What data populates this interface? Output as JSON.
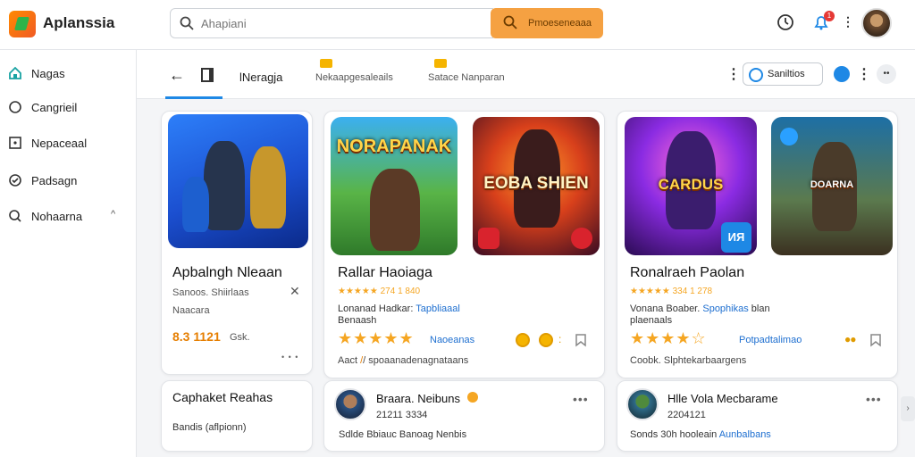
{
  "app": {
    "title": "Aplanssia"
  },
  "search": {
    "placeholder": "Ahapiani",
    "button_label": "Pmoeseneaaa"
  },
  "header": {
    "notification_count": "1"
  },
  "sidebar": {
    "items": [
      {
        "label": "Nagas",
        "icon": "home-icon"
      },
      {
        "label": "Cangrieil",
        "icon": "circle-icon"
      },
      {
        "label": "Nepaceaal",
        "icon": "square-dot-icon"
      },
      {
        "label": "Padsagn",
        "icon": "check-circle-icon"
      },
      {
        "label": "Nohaarna",
        "icon": "search-circle-icon",
        "chevron": "^"
      }
    ]
  },
  "toolbar": {
    "tabs": [
      {
        "label": "lNeragja"
      },
      {
        "label": "Nekaapgesaleails"
      },
      {
        "label": "Satace Nanparan"
      }
    ],
    "pill_label": "Saniltios",
    "circle_label": "••"
  },
  "cards": [
    {
      "title": "Apbalngh Nleaan",
      "meta": "Sanoos. Shiirlaas",
      "sub": "Naacara",
      "price": "8.3 1121",
      "price_suffix": "Gsk.",
      "footer_dots": "• • •"
    },
    {
      "title": "Rallar Haoiaga",
      "art_title": "NORAPANAK",
      "art_title2": "EOBA SHIEN",
      "rating_text": "★★★★★ 274 1 840",
      "desc": "Lonanad Hadkar:",
      "desc_link": "Tapbliaaal",
      "desc2": "Benaash",
      "stars": "★★★★★",
      "stars_label": "Naoeanas",
      "footer": "Aact",
      "footer2": "/ spoaanadenagnataans"
    },
    {
      "title": "Ronalraeh Paolan",
      "art_title": "CARDUS",
      "art_title2": "DOARNA",
      "badge_label": "ИЯ",
      "rating_text": "★★★★★ 334 1 278",
      "desc": "Vonana Boaber. ",
      "desc_link": "Spophikas",
      "desc_tail": "blan",
      "desc2": "plaenaals",
      "stars": "★★★★☆",
      "stars_label": "Potpadtalimao",
      "footer": "Coobk. Slphtekarbaargens"
    }
  ],
  "bottom_cards": [
    {
      "title": "Caphaket Reahas",
      "sub": "Bandis (aflpionn)"
    },
    {
      "title": "Braara. Neibuns",
      "nums": "21211 3334",
      "desc": "Sdlde Bbiauc Banoag Nenbis",
      "dots": "•••"
    },
    {
      "title": "Hlle Vola Mecbarame",
      "nums": "2204121",
      "desc": "Sonds 30h hooleain",
      "desc_link": "Aunbalbans",
      "dots": "•••"
    }
  ],
  "colors": {
    "accent": "#1e88e5",
    "search_button": "#f5a142",
    "star": "#f5a623"
  }
}
